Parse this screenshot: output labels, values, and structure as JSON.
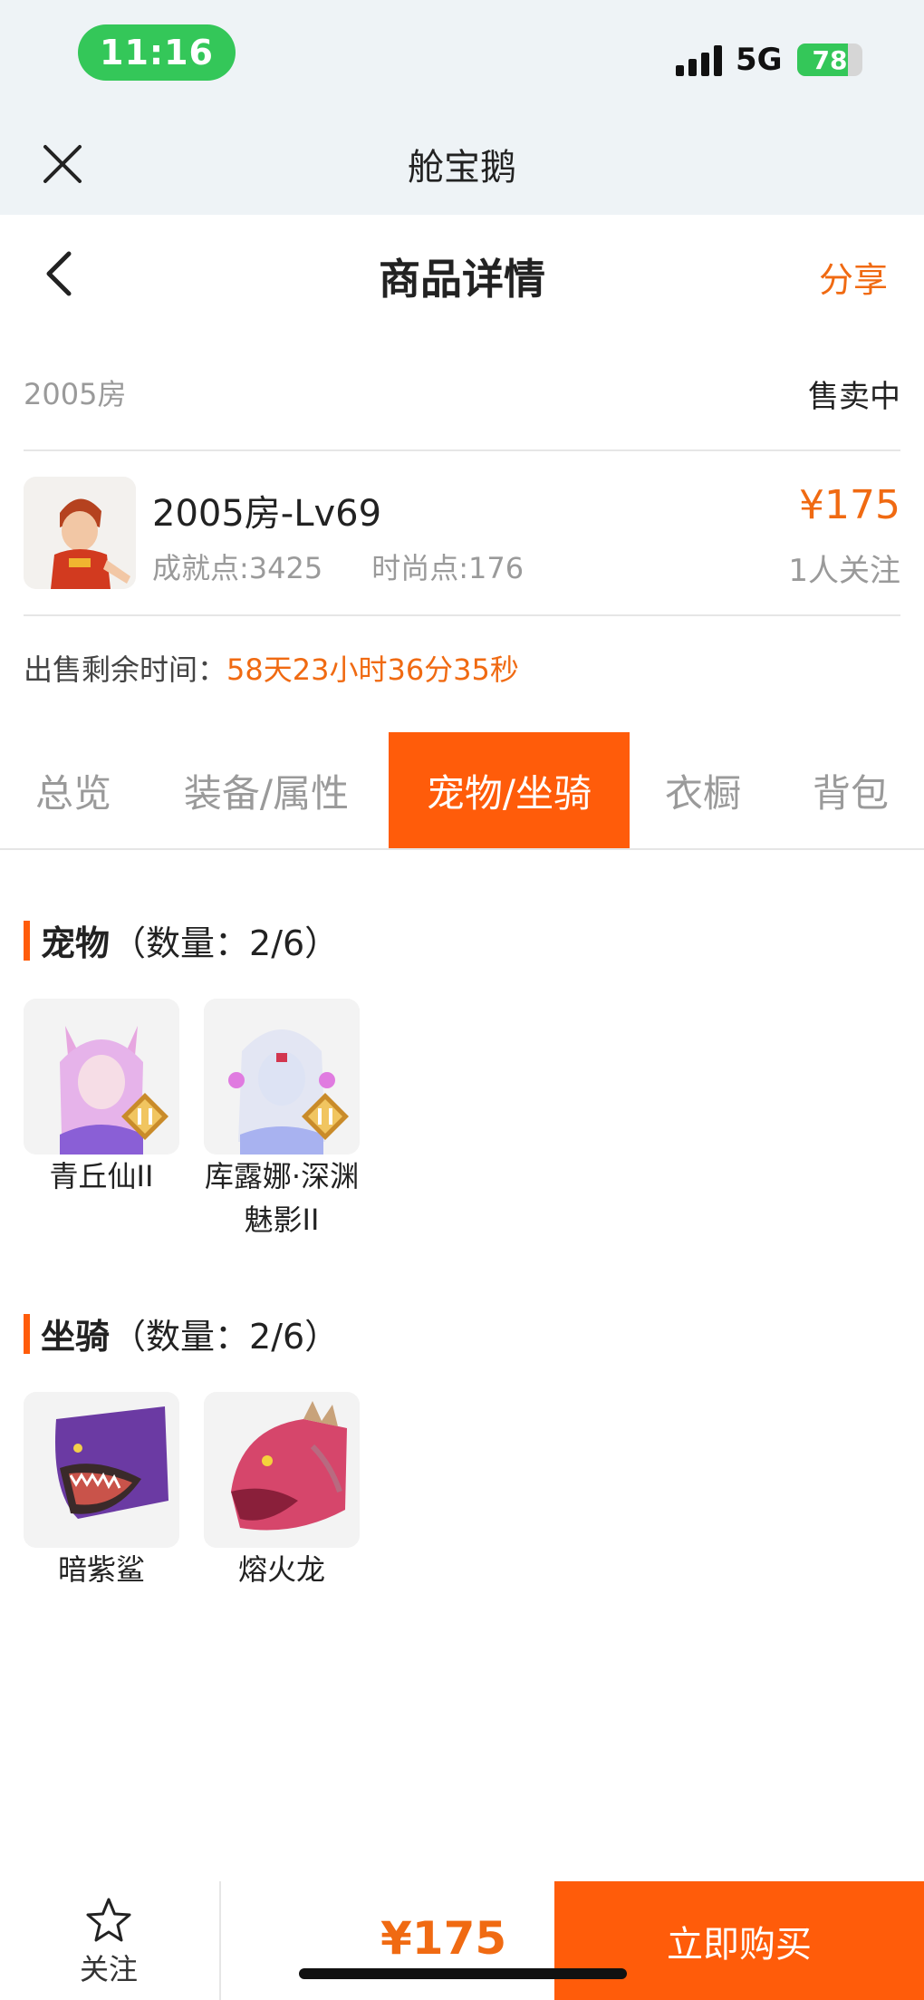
{
  "status_bar": {
    "time": "11:16",
    "network": "5G",
    "battery": "78",
    "battery_level": 0.78
  },
  "mini_program": {
    "title": "舱宝鹅"
  },
  "nav": {
    "title": "商品详情",
    "share_label": "分享"
  },
  "listing": {
    "server": "2005房",
    "status": "售卖中",
    "name": "2005房-Lv69",
    "achievement": "成就点:3425",
    "fashion": "时尚点:176",
    "price": "¥175",
    "followers": "1人关注",
    "remaining_label": "出售剩余时间：",
    "remaining_value": "58天23小时36分35秒"
  },
  "tabs": [
    {
      "label": "总览",
      "active": false
    },
    {
      "label": "装备/属性",
      "active": false
    },
    {
      "label": "宠物/坐骑",
      "active": true
    },
    {
      "label": "衣橱",
      "active": false
    },
    {
      "label": "背包",
      "active": false
    }
  ],
  "pets": {
    "title": "宠物",
    "count": "（数量：2/6）",
    "items": [
      {
        "name": "青丘仙II",
        "icon": "pet-fox-fairy-icon"
      },
      {
        "name": "库露娜·深渊魅影II",
        "icon": "pet-kuluna-icon"
      }
    ]
  },
  "mounts": {
    "title": "坐骑",
    "count": "（数量：2/6）",
    "items": [
      {
        "name": "暗紫鲨",
        "icon": "mount-purple-shark-icon"
      },
      {
        "name": "熔火龙",
        "icon": "mount-fire-dragon-icon"
      }
    ]
  },
  "bottom": {
    "follow_label": "关注",
    "price": "¥175",
    "buy_label": "立即购买"
  },
  "colors": {
    "accent": "#ff5c0a",
    "price": "#f06a12",
    "status_green": "#34c759"
  }
}
